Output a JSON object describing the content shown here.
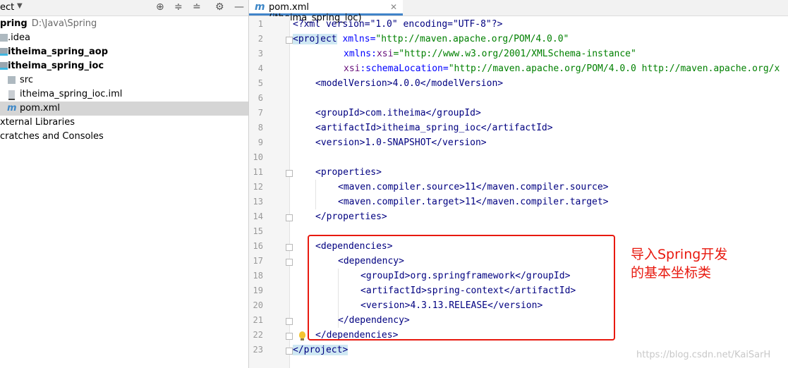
{
  "project_panel": {
    "title": "ect",
    "items": [
      {
        "label": "pring",
        "path": "D:\\Java\\Spring"
      },
      {
        "label": ".idea"
      },
      {
        "label": "itheima_spring_aop"
      },
      {
        "label": "itheima_spring_ioc"
      },
      {
        "label": "src"
      },
      {
        "label": "itheima_spring_ioc.iml"
      },
      {
        "label": "pom.xml",
        "selected": true
      },
      {
        "label": "xternal Libraries"
      },
      {
        "label": "cratches and Consoles"
      }
    ]
  },
  "editor": {
    "tab_label": "pom.xml (itheima_spring_ioc)",
    "line_numbers": [
      "1",
      "2",
      "3",
      "4",
      "5",
      "6",
      "7",
      "8",
      "9",
      "10",
      "11",
      "12",
      "13",
      "14",
      "15",
      "16",
      "17",
      "18",
      "19",
      "20",
      "21",
      "22",
      "23"
    ],
    "lines": {
      "l1": "<?xml version=\"1.0\" encoding=\"UTF-8\"?>",
      "l2_tag": "<project",
      "l2_attr": " xmlns=",
      "l2_val": "\"http://maven.apache.org/POM/4.0.0\"",
      "l3_attr": "xmlns:",
      "l3_ns": "xsi",
      "l3_val": "=\"http://www.w3.org/2001/XMLSchema-instance\"",
      "l4_ns": "xsi",
      "l4_attr": ":schemaLocation=",
      "l4_val": "\"http://maven.apache.org/POM/4.0.0 http://maven.apache.org/x",
      "l5": "<modelVersion>4.0.0</modelVersion>",
      "l7": "<groupId>com.itheima</groupId>",
      "l8": "<artifactId>itheima_spring_ioc</artifactId>",
      "l9": "<version>1.0-SNAPSHOT</version>",
      "l11": "<properties>",
      "l12": "<maven.compiler.source>11</maven.compiler.source>",
      "l13": "<maven.compiler.target>11</maven.compiler.target>",
      "l14": "</properties>",
      "l16": "<dependencies>",
      "l17": "<dependency>",
      "l18": "<groupId>org.springframework</groupId>",
      "l19": "<artifactId>spring-context</artifactId>",
      "l20": "<version>4.3.13.RELEASE</version>",
      "l21": "</dependency>",
      "l22": "</dependencies>",
      "l23": "</project>"
    }
  },
  "annotation": {
    "line1": "导入Spring开发",
    "line2": "的基本坐标类",
    "color": "#e8190f"
  },
  "watermark": "https://blog.csdn.net/KaiSarH"
}
